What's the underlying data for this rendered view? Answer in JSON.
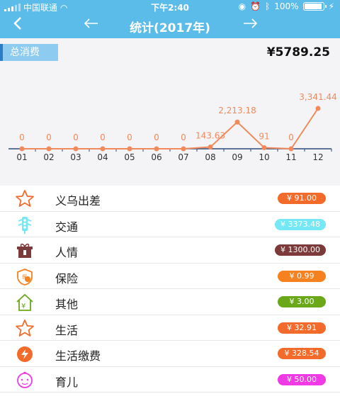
{
  "status": {
    "carrier": "中国联通",
    "time": "下午2:40",
    "battery": "100%"
  },
  "nav": {
    "title": "统计(2017年)",
    "back_icon": "chevron-left-icon",
    "prev_icon": "arrow-left-icon",
    "next_icon": "arrow-right-icon"
  },
  "summary": {
    "label": "总消费",
    "total": "¥5789.25"
  },
  "chart_data": {
    "type": "line",
    "categories": [
      "01",
      "02",
      "03",
      "04",
      "05",
      "06",
      "07",
      "08",
      "09",
      "10",
      "11",
      "12"
    ],
    "values": [
      0,
      0,
      0,
      0,
      0,
      0,
      0,
      143.63,
      2213.18,
      91,
      0,
      3341.44
    ],
    "data_labels": [
      "0",
      "0",
      "0",
      "0",
      "0",
      "0",
      "0",
      "143.63",
      "2,213.18",
      "91",
      "0",
      "3,341.44"
    ],
    "ylim": [
      0,
      3341.44
    ],
    "color": "#f08a5d",
    "axis_color": "#2d4a7a",
    "grid": false
  },
  "categories": [
    {
      "name": "义乌出差",
      "amount": "¥ 91.00",
      "color": "#f26b2a",
      "icon": "star-icon"
    },
    {
      "name": "交通",
      "amount": "¥ 3373.48",
      "color": "#74e8f5",
      "icon": "traffic-light-icon"
    },
    {
      "name": "人情",
      "amount": "¥ 1300.00",
      "color": "#7d3a3a",
      "icon": "gift-icon"
    },
    {
      "name": "保险",
      "amount": "¥ 0.99",
      "color": "#f5821f",
      "icon": "insurance-icon"
    },
    {
      "name": "其他",
      "amount": "¥ 3.00",
      "color": "#6aa81a",
      "icon": "house-yuan-icon"
    },
    {
      "name": "生活",
      "amount": "¥ 32.91",
      "color": "#f26b2a",
      "icon": "star-icon"
    },
    {
      "name": "生活缴费",
      "amount": "¥ 328.54",
      "color": "#f26b2a",
      "icon": "bolt-circle-icon"
    },
    {
      "name": "育儿",
      "amount": "¥ 50.00",
      "color": "#f03ae6",
      "icon": "baby-face-icon"
    }
  ]
}
